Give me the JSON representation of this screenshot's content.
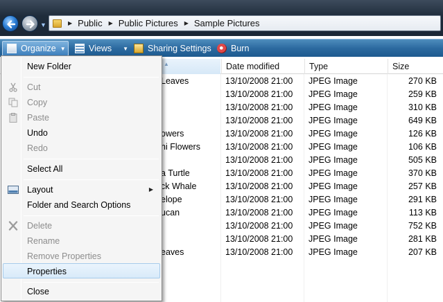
{
  "address_bar": {
    "breadcrumbs": [
      "Public",
      "Public Pictures",
      "Sample Pictures"
    ]
  },
  "command_bar": {
    "organize": "Organize",
    "views": "Views",
    "sharing": "Sharing Settings",
    "burn": "Burn"
  },
  "columns": {
    "date": "Date modified",
    "type": "Type",
    "size": "Size"
  },
  "files": [
    {
      "name": "Leaves",
      "date": "13/10/2008 21:00",
      "type": "JPEG Image",
      "size": "270 KB"
    },
    {
      "name": "",
      "date": "13/10/2008 21:00",
      "type": "JPEG Image",
      "size": "259 KB"
    },
    {
      "name": "",
      "date": "13/10/2008 21:00",
      "type": "JPEG Image",
      "size": "310 KB"
    },
    {
      "name": "",
      "date": "13/10/2008 21:00",
      "type": "JPEG Image",
      "size": "649 KB"
    },
    {
      "name": "owers",
      "date": "13/10/2008 21:00",
      "type": "JPEG Image",
      "size": "126 KB"
    },
    {
      "name": "ni Flowers",
      "date": "13/10/2008 21:00",
      "type": "JPEG Image",
      "size": "106 KB"
    },
    {
      "name": "",
      "date": "13/10/2008 21:00",
      "type": "JPEG Image",
      "size": "505 KB"
    },
    {
      "name": "a Turtle",
      "date": "13/10/2008 21:00",
      "type": "JPEG Image",
      "size": "370 KB"
    },
    {
      "name": "ck Whale",
      "date": "13/10/2008 21:00",
      "type": "JPEG Image",
      "size": "257 KB"
    },
    {
      "name": "elope",
      "date": "13/10/2008 21:00",
      "type": "JPEG Image",
      "size": "291 KB"
    },
    {
      "name": "ucan",
      "date": "13/10/2008 21:00",
      "type": "JPEG Image",
      "size": "113 KB"
    },
    {
      "name": "",
      "date": "13/10/2008 21:00",
      "type": "JPEG Image",
      "size": "752 KB"
    },
    {
      "name": "",
      "date": "13/10/2008 21:00",
      "type": "JPEG Image",
      "size": "281 KB"
    },
    {
      "name": "eaves",
      "date": "13/10/2008 21:00",
      "type": "JPEG Image",
      "size": "207 KB"
    }
  ],
  "menu": {
    "new_folder": "New Folder",
    "cut": "Cut",
    "copy": "Copy",
    "paste": "Paste",
    "undo": "Undo",
    "redo": "Redo",
    "select_all": "Select All",
    "layout": "Layout",
    "folder_options": "Folder and Search Options",
    "delete": "Delete",
    "rename": "Rename",
    "remove_properties": "Remove Properties",
    "properties": "Properties",
    "close": "Close"
  }
}
